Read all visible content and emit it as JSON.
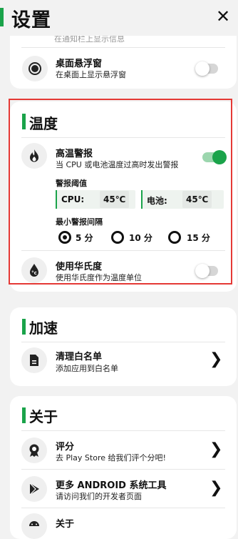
{
  "header": {
    "title": "设置",
    "close_glyph": "✕"
  },
  "top_card": {
    "partial_sub": "在通知栏上显示信息",
    "floating_window": {
      "title": "桌面悬浮窗",
      "subtitle": "在桌面上显示悬浮窗",
      "enabled": false
    }
  },
  "temperature": {
    "section_title": "温度",
    "high_temp_alert": {
      "title": "高温警报",
      "subtitle": "当 CPU 或电池温度过高时发出警报",
      "enabled": true
    },
    "threshold_label": "警报阈值",
    "cpu": {
      "label": "CPU:",
      "value": "45℃"
    },
    "battery": {
      "label": "电池:",
      "value": "45℃"
    },
    "interval_label": "最小警报间隔",
    "interval_options": [
      {
        "label": "5 分",
        "selected": true
      },
      {
        "label": "10 分",
        "selected": false
      },
      {
        "label": "15 分",
        "selected": false
      }
    ],
    "fahrenheit": {
      "title": "使用华氏度",
      "subtitle": "使用华氏度作为温度单位",
      "enabled": false
    }
  },
  "accelerate": {
    "section_title": "加速",
    "whitelist": {
      "title": "清理白名单",
      "subtitle": "添加应用到白名单"
    }
  },
  "about": {
    "section_title": "关于",
    "rate": {
      "title": "评分",
      "subtitle": "去 Play Store 给我们评个分吧!"
    },
    "more_tools": {
      "title": "更多 ANDROID 系统工具",
      "subtitle": "请访问我们的开发者页面"
    },
    "about_item": {
      "title": "关于"
    }
  },
  "colors": {
    "accent": "#1aa34a",
    "highlight": "#e53935"
  }
}
